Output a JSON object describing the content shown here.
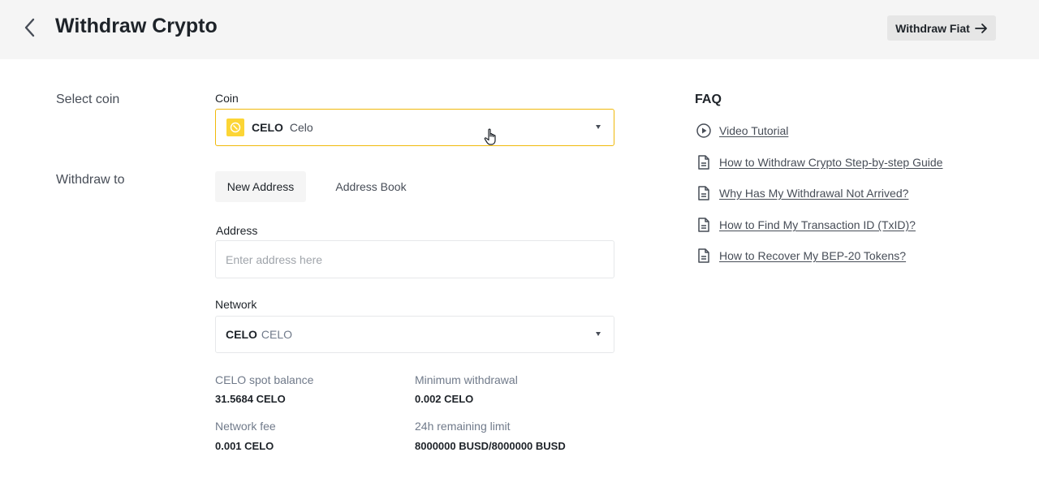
{
  "header": {
    "title": "Withdraw Crypto",
    "fiat_button_label": "Withdraw Fiat"
  },
  "select_coin": {
    "section_label": "Select coin",
    "field_label": "Coin",
    "selected_symbol": "CELO",
    "selected_name": "Celo"
  },
  "withdraw_to": {
    "section_label": "Withdraw to",
    "tabs": [
      {
        "label": "New Address",
        "active": true
      },
      {
        "label": "Address Book",
        "active": false
      }
    ],
    "address_label": "Address",
    "address_placeholder": "Enter address here",
    "network_label": "Network",
    "network_symbol": "CELO",
    "network_name": "CELO"
  },
  "info": {
    "spot_balance_label": "CELO spot balance",
    "spot_balance_value": "31.5684 CELO",
    "min_withdrawal_label": "Minimum withdrawal",
    "min_withdrawal_value": "0.002 CELO",
    "network_fee_label": "Network fee",
    "network_fee_value": "0.001 CELO",
    "remaining_limit_label": "24h remaining limit",
    "remaining_limit_value": "8000000 BUSD/8000000 BUSD"
  },
  "faq": {
    "title": "FAQ",
    "items": [
      {
        "label": "Video Tutorial",
        "icon": "play-circle-icon"
      },
      {
        "label": "How to Withdraw Crypto Step-by-step Guide",
        "icon": "document-icon"
      },
      {
        "label": "Why Has My Withdrawal Not Arrived?",
        "icon": "document-icon"
      },
      {
        "label": "How to Find My Transaction ID (TxID)?",
        "icon": "document-icon"
      },
      {
        "label": "How to Recover My BEP-20 Tokens?",
        "icon": "document-icon"
      }
    ]
  },
  "colors": {
    "accent": "#f0b90b",
    "coin_logo": "#fcd535",
    "header_bg": "#f5f5f5"
  }
}
